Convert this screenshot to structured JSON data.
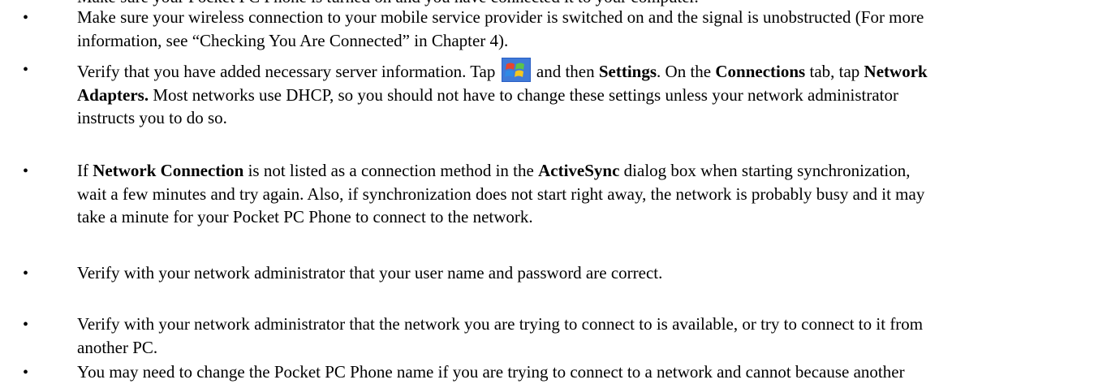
{
  "cutoff_line": "Make sure your Pocket PC Phone is turned on and you have connected it to your computer.",
  "bullets": [
    {
      "lines": [
        "Make sure your wireless connection to your mobile service provider is switched on and the signal is unobstructed (For more",
        "information, see “Checking You Are Connected” in Chapter 4)."
      ]
    },
    {
      "l1_a": "Verify that you have added necessary server information. Tap",
      "l1_b": "and then",
      "l1_c": "Settings",
      "l1_d": ". On the",
      "l1_e": "Connections",
      "l1_f": "tab, tap",
      "l1_g": "Network",
      "l2_a": "Adapters.",
      "l2_b": "Most networks use DHCP, so you should not have to change these settings unless your network administrator",
      "l3": "instructs you to do so."
    },
    {
      "l1_a": "If",
      "l1_b": "Network Connection",
      "l1_c": "is not listed as a connection method in the",
      "l1_d": "ActiveSync",
      "l1_e": "dialog box when starting synchronization,",
      "l2": "wait a few minutes and try again. Also, if synchronization does not start right away, the network is probably busy and it may",
      "l3": "take a minute for your Pocket PC Phone to connect to the network."
    },
    {
      "lines": [
        "Verify with your network administrator that your user name and password are correct."
      ]
    },
    {
      "lines": [
        "Verify with your network administrator that the network you are trying to connect to is available, or try to connect to it from",
        "another PC."
      ]
    },
    {
      "lines": [
        "You may need to change the Pocket PC Phone name if you are trying to connect to a network and cannot because another"
      ]
    }
  ],
  "bullet_glyph": "•",
  "icons": {
    "start": "windows-start-flag-icon"
  }
}
